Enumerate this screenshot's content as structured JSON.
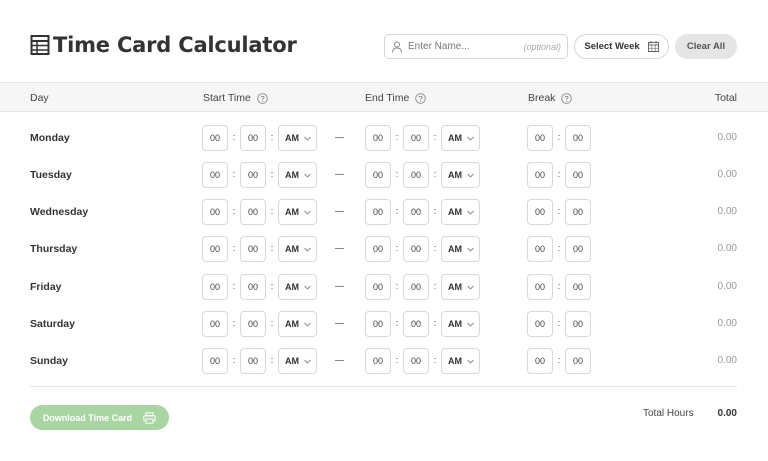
{
  "header": {
    "title": "Time Card Calculator",
    "name_placeholder": "Enter Name...",
    "name_value": "",
    "optional_hint": "(optional)",
    "select_week_label": "Select Week",
    "clear_all_label": "Clear All"
  },
  "table": {
    "columns": {
      "day": "Day",
      "start_time": "Start Time",
      "end_time": "End Time",
      "break": "Break",
      "total": "Total"
    },
    "separator": ":",
    "rows": [
      {
        "day": "Monday",
        "start": {
          "hour": "00",
          "minute": "00",
          "period": "AM"
        },
        "end": {
          "hour": "00",
          "minute": "00",
          "period": "AM"
        },
        "break": {
          "hours": "00",
          "minutes": "00"
        },
        "total": "0.00"
      },
      {
        "day": "Tuesday",
        "start": {
          "hour": "00",
          "minute": "00",
          "period": "AM"
        },
        "end": {
          "hour": "00",
          "minute": "00",
          "period": "AM"
        },
        "break": {
          "hours": "00",
          "minutes": "00"
        },
        "total": "0.00"
      },
      {
        "day": "Wednesday",
        "start": {
          "hour": "00",
          "minute": "00",
          "period": "AM"
        },
        "end": {
          "hour": "00",
          "minute": "00",
          "period": "AM"
        },
        "break": {
          "hours": "00",
          "minutes": "00"
        },
        "total": "0.00"
      },
      {
        "day": "Thursday",
        "start": {
          "hour": "00",
          "minute": "00",
          "period": "AM"
        },
        "end": {
          "hour": "00",
          "minute": "00",
          "period": "AM"
        },
        "break": {
          "hours": "00",
          "minutes": "00"
        },
        "total": "0.00"
      },
      {
        "day": "Friday",
        "start": {
          "hour": "00",
          "minute": "00",
          "period": "AM"
        },
        "end": {
          "hour": "00",
          "minute": "00",
          "period": "AM"
        },
        "break": {
          "hours": "00",
          "minutes": "00"
        },
        "total": "0.00"
      },
      {
        "day": "Saturday",
        "start": {
          "hour": "00",
          "minute": "00",
          "period": "AM"
        },
        "end": {
          "hour": "00",
          "minute": "00",
          "period": "AM"
        },
        "break": {
          "hours": "00",
          "minutes": "00"
        },
        "total": "0.00"
      },
      {
        "day": "Sunday",
        "start": {
          "hour": "00",
          "minute": "00",
          "period": "AM"
        },
        "end": {
          "hour": "00",
          "minute": "00",
          "period": "AM"
        },
        "break": {
          "hours": "00",
          "minutes": "00"
        },
        "total": "0.00"
      }
    ]
  },
  "footer": {
    "download_label": "Download Time Card",
    "total_hours_label": "Total Hours",
    "total_hours_value": "0.00"
  },
  "icons": {
    "title": "table-icon",
    "name": "user-icon",
    "week": "calendar-icon",
    "help": "help-circle-icon",
    "dropdown": "chevron-down-icon",
    "download": "printer-icon"
  },
  "colors": {
    "accent": "#a8d5a2",
    "header_bg": "#f6f6f6",
    "clear_bg": "#e5e5e5"
  }
}
